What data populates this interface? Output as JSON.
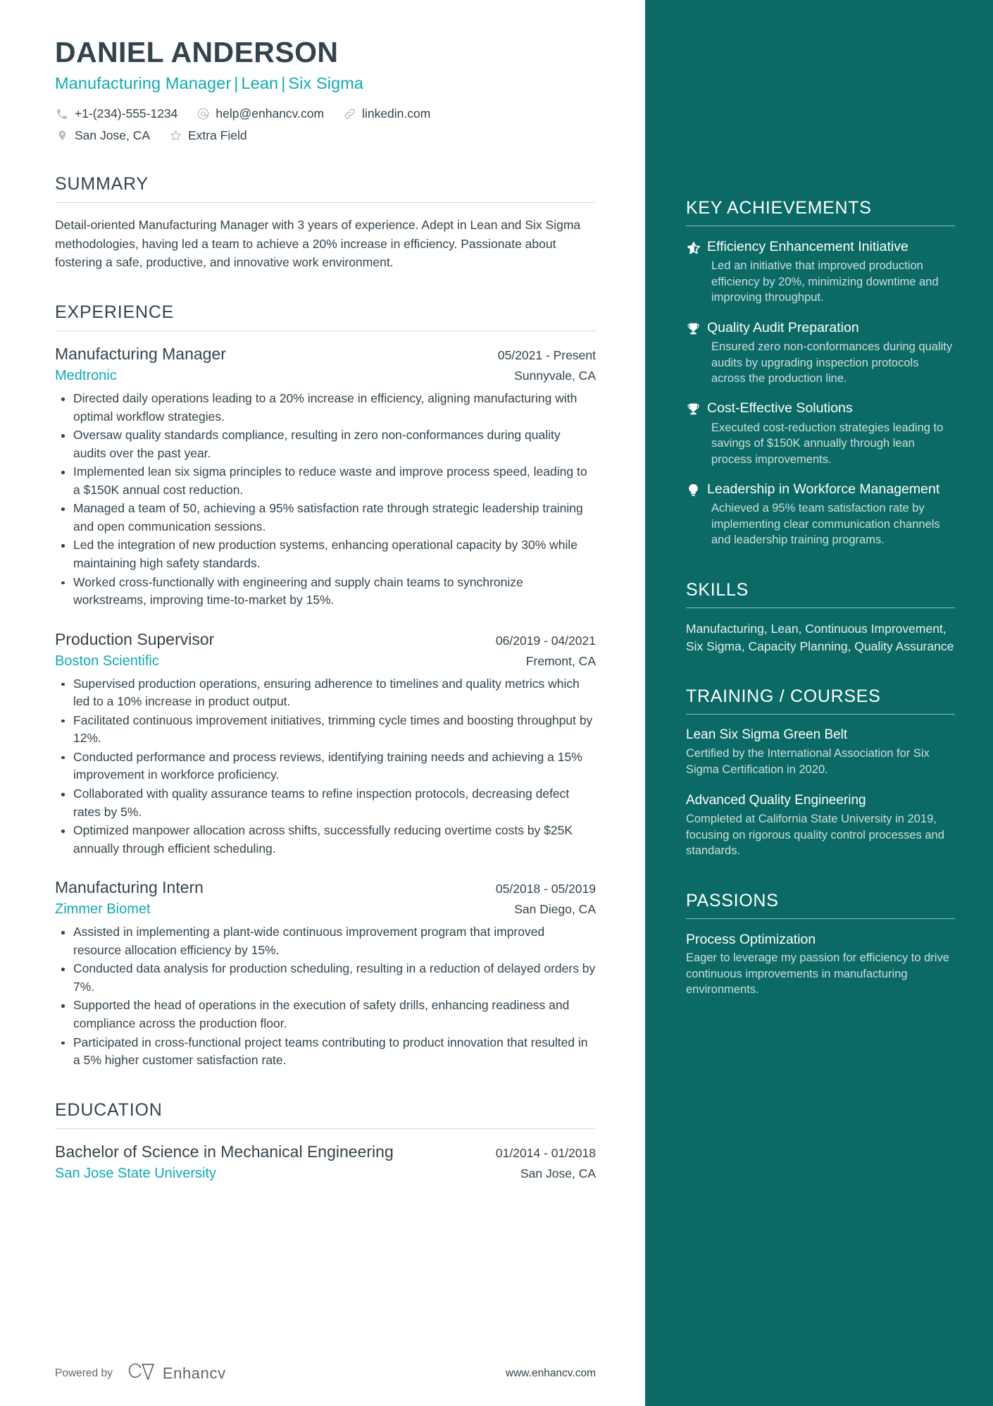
{
  "header": {
    "name": "DANIEL ANDERSON",
    "headline_parts": [
      "Manufacturing Manager",
      "Lean",
      "Six Sigma"
    ],
    "headline_separator": "|",
    "contacts_row1": [
      {
        "icon": "phone-icon",
        "text": "+1-(234)-555-1234"
      },
      {
        "icon": "email-icon",
        "text": "help@enhancv.com"
      },
      {
        "icon": "link-icon",
        "text": "linkedin.com"
      }
    ],
    "contacts_row2": [
      {
        "icon": "location-pin-icon",
        "text": "San Jose, CA"
      },
      {
        "icon": "star-outline-icon",
        "text": "Extra Field"
      }
    ]
  },
  "summary": {
    "title": "SUMMARY",
    "text": "Detail-oriented Manufacturing Manager with 3 years of experience. Adept in Lean and Six Sigma methodologies, having led a team to achieve a 20% increase in efficiency. Passionate about fostering a safe, productive, and innovative work environment."
  },
  "experience": {
    "title": "EXPERIENCE",
    "entries": [
      {
        "role": "Manufacturing Manager",
        "date": "05/2021 - Present",
        "company": "Medtronic",
        "location": "Sunnyvale, CA",
        "bullets": [
          "Directed daily operations leading to a 20% increase in efficiency, aligning manufacturing with optimal workflow strategies.",
          "Oversaw quality standards compliance, resulting in zero non-conformances during quality audits over the past year.",
          "Implemented lean six sigma principles to reduce waste and improve process speed, leading to a $150K annual cost reduction.",
          "Managed a team of 50, achieving a 95% satisfaction rate through strategic leadership training and open communication sessions.",
          "Led the integration of new production systems, enhancing operational capacity by 30% while maintaining high safety standards.",
          "Worked cross-functionally with engineering and supply chain teams to synchronize workstreams, improving time-to-market by 15%."
        ]
      },
      {
        "role": "Production Supervisor",
        "date": "06/2019 - 04/2021",
        "company": "Boston Scientific",
        "location": "Fremont, CA",
        "bullets": [
          "Supervised production operations, ensuring adherence to timelines and quality metrics which led to a 10% increase in product output.",
          "Facilitated continuous improvement initiatives, trimming cycle times and boosting throughput by 12%.",
          "Conducted performance and process reviews, identifying training needs and achieving a 15% improvement in workforce proficiency.",
          "Collaborated with quality assurance teams to refine inspection protocols, decreasing defect rates by 5%.",
          "Optimized manpower allocation across shifts, successfully reducing overtime costs by $25K annually through efficient scheduling."
        ]
      },
      {
        "role": "Manufacturing Intern",
        "date": "05/2018 - 05/2019",
        "company": "Zimmer Biomet",
        "location": "San Diego, CA",
        "bullets": [
          "Assisted in implementing a plant-wide continuous improvement program that improved resource allocation efficiency by 15%.",
          "Conducted data analysis for production scheduling, resulting in a reduction of delayed orders by 7%.",
          "Supported the head of operations in the execution of safety drills, enhancing readiness and compliance across the production floor.",
          "Participated in cross-functional project teams contributing to product innovation that resulted in a 5% higher customer satisfaction rate."
        ]
      }
    ]
  },
  "education": {
    "title": "EDUCATION",
    "entries": [
      {
        "degree": "Bachelor of Science in Mechanical Engineering",
        "date": "01/2014 - 01/2018",
        "school": "San Jose State University",
        "location": "San Jose, CA"
      }
    ]
  },
  "key_achievements": {
    "title": "KEY ACHIEVEMENTS",
    "items": [
      {
        "icon": "half-star-icon",
        "title": "Efficiency Enhancement Initiative",
        "description": "Led an initiative that improved production efficiency by 20%, minimizing downtime and improving throughput."
      },
      {
        "icon": "trophy-icon",
        "title": "Quality Audit Preparation",
        "description": "Ensured zero non-conformances during quality audits by upgrading inspection protocols across the production line."
      },
      {
        "icon": "trophy-icon",
        "title": "Cost-Effective Solutions",
        "description": "Executed cost-reduction strategies leading to savings of $150K annually through lean process improvements."
      },
      {
        "icon": "lightbulb-icon",
        "title": "Leadership in Workforce Management",
        "description": "Achieved a 95% team satisfaction rate by implementing clear communication channels and leadership training programs."
      }
    ]
  },
  "skills": {
    "title": "SKILLS",
    "text": "Manufacturing, Lean, Continuous Improvement, Six Sigma, Capacity Planning, Quality Assurance"
  },
  "training": {
    "title": "TRAINING / COURSES",
    "items": [
      {
        "name": "Lean Six Sigma Green Belt",
        "description": "Certified by the International Association for Six Sigma Certification in 2020."
      },
      {
        "name": "Advanced Quality Engineering",
        "description": "Completed at California State University in 2019, focusing on rigorous quality control processes and standards."
      }
    ]
  },
  "passions": {
    "title": "PASSIONS",
    "items": [
      {
        "name": "Process Optimization",
        "description": "Eager to leverage my passion for efficiency to drive continuous improvements in manufacturing environments."
      }
    ]
  },
  "footer": {
    "powered_by": "Powered by",
    "brand": "Enhancv",
    "website": "www.enhancv.com"
  },
  "colors": {
    "accent_teal": "#11aab3",
    "sidebar_bg": "#0b6a66",
    "text_dark": "#33434d"
  }
}
